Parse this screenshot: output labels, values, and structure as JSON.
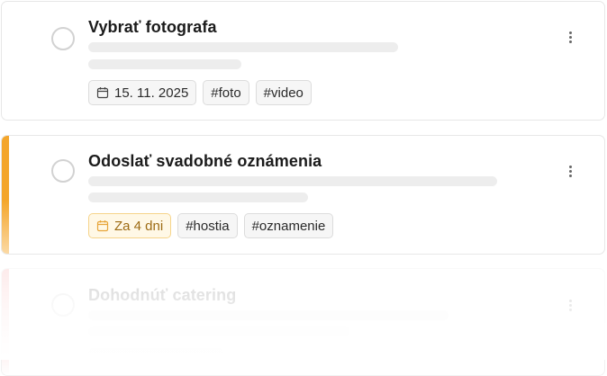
{
  "colors": {
    "accent_orange": "#f4a62c",
    "accent_red": "#f6a8a8",
    "warn_tag_border": "#f6d48a",
    "warn_tag_text": "#9c6a12"
  },
  "tasks": [
    {
      "title": "Vybrať fotografa",
      "priority": "none",
      "due": "15. 11. 2025",
      "due_icon": "calendar-icon",
      "tags": [
        "#foto",
        "#video"
      ],
      "menu_icon": "more-vertical-icon"
    },
    {
      "title": "Odoslať svadobné oznámenia",
      "priority": "high",
      "due": "Za 4 dni",
      "due_icon": "calendar-icon",
      "tags": [
        "#hostia",
        "#oznamenie"
      ],
      "menu_icon": "more-vertical-icon"
    },
    {
      "title": "Dohodnúť catering",
      "priority": "urgent",
      "faded": true,
      "menu_icon": "more-vertical-icon"
    }
  ]
}
